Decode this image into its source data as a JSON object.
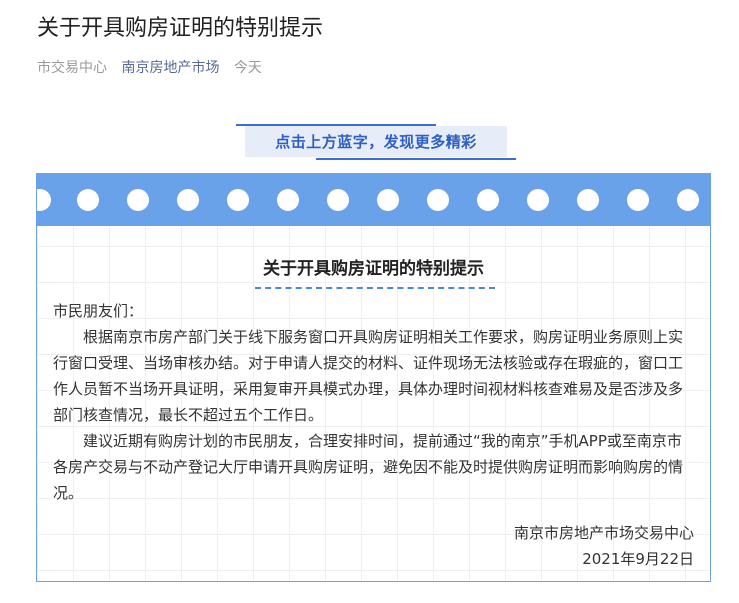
{
  "article": {
    "title": "关于开具购房证明的特别提示",
    "meta": {
      "source": "市交易中心",
      "account": "南京房地产市场",
      "time": "今天"
    }
  },
  "promo": {
    "text": "点击上方蓝字，发现更多精彩"
  },
  "notice": {
    "title": "关于开具购房证明的特别提示",
    "greeting": "市民朋友们：",
    "paragraph1": "根据南京市房产部门关于线下服务窗口开具购房证明相关工作要求，购房证明业务原则上实行窗口受理、当场审核办结。对于申请人提交的材料、证件现场无法核验或存在瑕疵的，窗口工作人员暂不当场开具证明，采用复审开具模式办理，具体办理时间视材料核查难易及是否涉及多部门核查情况，最长不超过五个工作日。",
    "paragraph2": "建议近期有购房计划的市民朋友，合理安排时间，提前通过“我的南京”手机APP或至南京市各房产交易与不动产登记大厅申请开具购房证明，避免因不能及时提供购房证明而影响购房的情况。",
    "signature_org": "南京市房地产市场交易中心",
    "signature_date": "2021年9月22日"
  },
  "colors": {
    "card_header": "#6aa2ea",
    "promo_bg": "#e6edf8",
    "promo_text": "#2d5fc6",
    "account_link": "#576b95"
  }
}
